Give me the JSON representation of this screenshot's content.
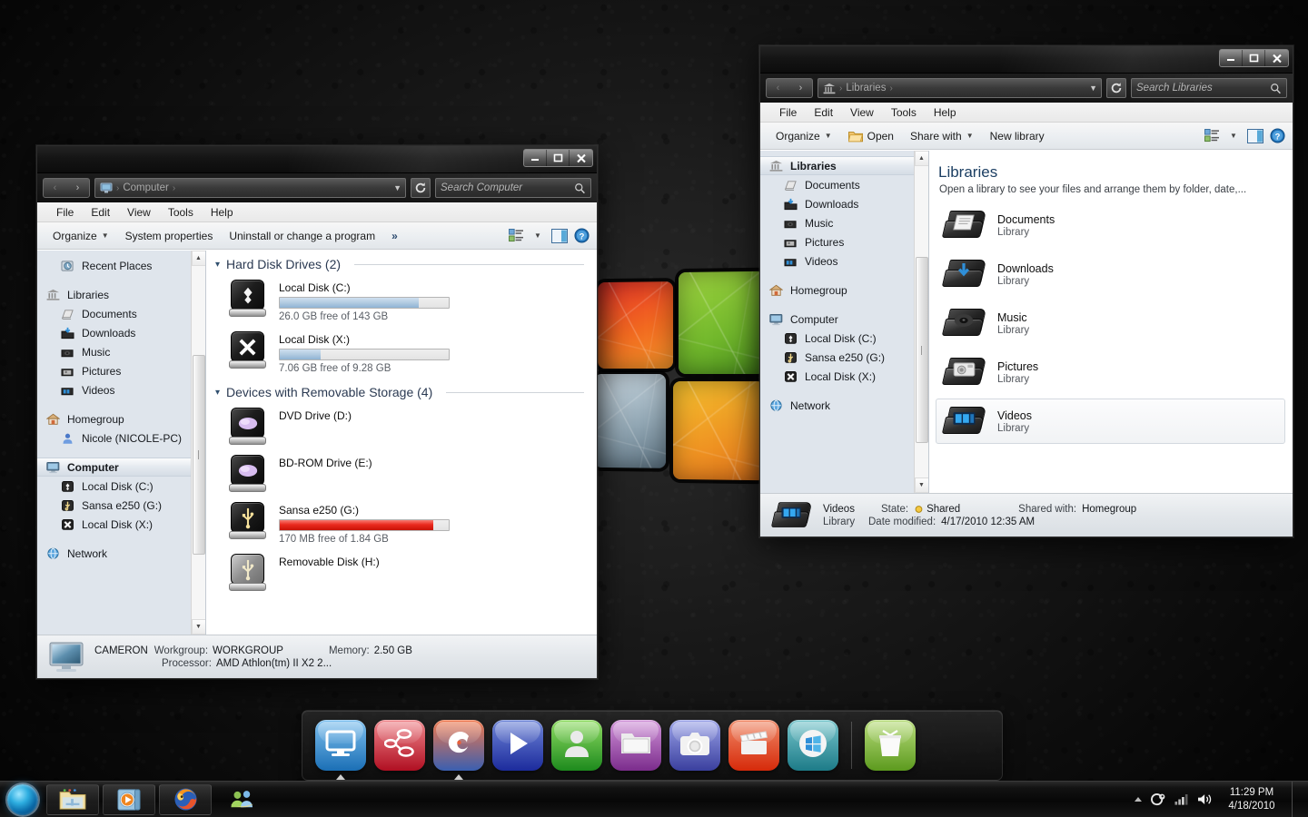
{
  "desktop": {
    "wallpaper_name": "windows-grunge-leather"
  },
  "computer_window": {
    "title": "Computer",
    "controls": {
      "minimize": "minimize-button",
      "maximize": "maximize-button",
      "close": "close-button"
    },
    "nav": {
      "back": "back-button",
      "forward": "forward-button",
      "refresh": "refresh-button"
    },
    "address": {
      "root_icon": "computer-icon",
      "crumb": "Computer",
      "sep": "›"
    },
    "search": {
      "placeholder": "Search Computer",
      "value": ""
    },
    "menu": [
      "File",
      "Edit",
      "View",
      "Tools",
      "Help"
    ],
    "commands": {
      "organize": "Organize",
      "system_properties": "System properties",
      "uninstall": "Uninstall or change a program",
      "overflow": "»",
      "change_view": "change-view-button",
      "preview_pane": "preview-pane-button",
      "help": "help-button"
    },
    "sidebar": [
      {
        "label": "Recent Places",
        "icon": "recent-places-icon",
        "level": "child",
        "selected": false
      },
      {
        "label": "",
        "icon": "",
        "level": "gap",
        "selected": false
      },
      {
        "label": "Libraries",
        "icon": "libraries-icon",
        "level": "root",
        "selected": false
      },
      {
        "label": "Documents",
        "icon": "documents-icon",
        "level": "child",
        "selected": false
      },
      {
        "label": "Downloads",
        "icon": "downloads-icon",
        "level": "child",
        "selected": false
      },
      {
        "label": "Music",
        "icon": "music-icon",
        "level": "child",
        "selected": false
      },
      {
        "label": "Pictures",
        "icon": "pictures-icon",
        "level": "child",
        "selected": false
      },
      {
        "label": "Videos",
        "icon": "videos-icon",
        "level": "child",
        "selected": false
      },
      {
        "label": "",
        "icon": "",
        "level": "gap",
        "selected": false
      },
      {
        "label": "Homegroup",
        "icon": "homegroup-icon",
        "level": "root",
        "selected": false
      },
      {
        "label": "Nicole (NICOLE-PC)",
        "icon": "user-icon",
        "level": "child",
        "selected": false
      },
      {
        "label": "",
        "icon": "",
        "level": "gap",
        "selected": false
      },
      {
        "label": "Computer",
        "icon": "computer-icon",
        "level": "root",
        "selected": true
      },
      {
        "label": "Local Disk (C:)",
        "icon": "local-disk-c-icon",
        "level": "child",
        "selected": false
      },
      {
        "label": "Sansa e250 (G:)",
        "icon": "usb-drive-icon",
        "level": "child",
        "selected": false
      },
      {
        "label": "Local Disk (X:)",
        "icon": "local-disk-x-icon",
        "level": "child",
        "selected": false
      },
      {
        "label": "",
        "icon": "",
        "level": "gap",
        "selected": false
      },
      {
        "label": "Network",
        "icon": "network-icon",
        "level": "root",
        "selected": false
      }
    ],
    "groups": [
      {
        "header": "Hard Disk Drives (2)",
        "drives": [
          {
            "name": "Local Disk (C:)",
            "free": "26.0 GB free of 143 GB",
            "used_percent": 82,
            "bar": "normal",
            "icon": "hard-disk-icon",
            "glyph": "diamonds"
          },
          {
            "name": "Local Disk (X:)",
            "free": "7.06 GB free of 9.28 GB",
            "used_percent": 24,
            "bar": "normal",
            "icon": "hard-disk-x-icon",
            "glyph": "X"
          }
        ]
      },
      {
        "header": "Devices with Removable Storage (4)",
        "drives": [
          {
            "name": "DVD Drive (D:)",
            "free": "",
            "used_percent": 0,
            "bar": "none",
            "icon": "dvd-drive-icon",
            "glyph": "disc"
          },
          {
            "name": "BD-ROM Drive (E:)",
            "free": "",
            "used_percent": 0,
            "bar": "none",
            "icon": "bd-rom-drive-icon",
            "glyph": "disc"
          },
          {
            "name": "Sansa e250 (G:)",
            "free": "170 MB free of 1.84 GB",
            "used_percent": 91,
            "bar": "low",
            "icon": "usb-drive-icon",
            "glyph": "usb"
          },
          {
            "name": "Removable Disk (H:)",
            "free": "",
            "used_percent": 0,
            "bar": "none",
            "icon": "removable-disk-icon",
            "glyph": "usb-grey"
          }
        ]
      }
    ],
    "status": {
      "machine": "CAMERON",
      "workgroup_label": "Workgroup:",
      "workgroup_value": "WORKGROUP",
      "memory_label": "Memory:",
      "memory_value": "2.50 GB",
      "processor_label": "Processor:",
      "processor_value": "AMD Athlon(tm) II X2 2..."
    }
  },
  "libraries_window": {
    "title": "Libraries",
    "nav": {
      "back": "back-button",
      "forward": "forward-button",
      "refresh": "refresh-button"
    },
    "address": {
      "root_icon": "libraries-icon",
      "crumb": "Libraries",
      "sep": "›"
    },
    "search": {
      "placeholder": "Search Libraries",
      "value": ""
    },
    "menu": [
      "File",
      "Edit",
      "View",
      "Tools",
      "Help"
    ],
    "commands": {
      "organize": "Organize",
      "open": "Open",
      "share_with": "Share with",
      "new_library": "New library",
      "change_view": "change-view-button",
      "preview_pane": "preview-pane-button",
      "help": "help-button"
    },
    "sidebar": [
      {
        "label": "Libraries",
        "icon": "libraries-icon",
        "level": "root",
        "selected": true
      },
      {
        "label": "Documents",
        "icon": "documents-icon",
        "level": "child",
        "selected": false
      },
      {
        "label": "Downloads",
        "icon": "downloads-icon",
        "level": "child",
        "selected": false
      },
      {
        "label": "Music",
        "icon": "music-icon",
        "level": "child",
        "selected": false
      },
      {
        "label": "Pictures",
        "icon": "pictures-icon",
        "level": "child",
        "selected": false
      },
      {
        "label": "Videos",
        "icon": "videos-icon",
        "level": "child",
        "selected": false
      },
      {
        "label": "",
        "icon": "",
        "level": "gap",
        "selected": false
      },
      {
        "label": "Homegroup",
        "icon": "homegroup-icon",
        "level": "root",
        "selected": false
      },
      {
        "label": "",
        "icon": "",
        "level": "gap",
        "selected": false
      },
      {
        "label": "Computer",
        "icon": "computer-icon",
        "level": "root",
        "selected": false
      },
      {
        "label": "Local Disk (C:)",
        "icon": "local-disk-c-icon",
        "level": "child",
        "selected": false
      },
      {
        "label": "Sansa e250 (G:)",
        "icon": "usb-drive-icon",
        "level": "child",
        "selected": false
      },
      {
        "label": "Local Disk (X:)",
        "icon": "local-disk-x-icon",
        "level": "child",
        "selected": false
      },
      {
        "label": "",
        "icon": "",
        "level": "gap",
        "selected": false
      },
      {
        "label": "Network",
        "icon": "network-icon",
        "level": "root",
        "selected": false
      }
    ],
    "content_header": {
      "title": "Libraries",
      "subtitle": "Open a library to see your files and arrange them by folder, date,..."
    },
    "items": [
      {
        "name": "Documents",
        "type": "Library",
        "icon": "documents-library-icon",
        "selected": false
      },
      {
        "name": "Downloads",
        "type": "Library",
        "icon": "downloads-library-icon",
        "selected": false
      },
      {
        "name": "Music",
        "type": "Library",
        "icon": "music-library-icon",
        "selected": false
      },
      {
        "name": "Pictures",
        "type": "Library",
        "icon": "pictures-library-icon",
        "selected": false
      },
      {
        "name": "Videos",
        "type": "Library",
        "icon": "videos-library-icon",
        "selected": true
      }
    ],
    "details": {
      "name": "Videos",
      "type": "Library",
      "state_label": "State:",
      "state_value": "Shared",
      "shared_label": "Shared with:",
      "shared_value": "Homegroup",
      "date_label": "Date modified:",
      "date_value": "4/17/2010 12:35 AM"
    }
  },
  "dock": {
    "items": [
      {
        "name": "my-computer",
        "icon": "monitor-icon",
        "c1": "#7ec0ef",
        "c2": "#1b6fb5"
      },
      {
        "name": "network",
        "icon": "network-share-icon",
        "c1": "#f0868c",
        "c2": "#b00f22"
      },
      {
        "name": "firefox",
        "icon": "firefox-icon",
        "c1": "#f2784b",
        "c2": "#3a5fb0"
      },
      {
        "name": "media-player",
        "icon": "play-icon",
        "c1": "#6f86d8",
        "c2": "#1c2b9c"
      },
      {
        "name": "user-account",
        "icon": "person-icon",
        "c1": "#8fdc62",
        "c2": "#1d8a1d"
      },
      {
        "name": "documents-folder",
        "icon": "folder-icon",
        "c1": "#d194d9",
        "c2": "#7b2c8c"
      },
      {
        "name": "photos",
        "icon": "camera-icon",
        "c1": "#9ba3e8",
        "c2": "#3a3f9e"
      },
      {
        "name": "movies",
        "icon": "clapboard-icon",
        "c1": "#f08a68",
        "c2": "#d62a0a"
      },
      {
        "name": "windows-start",
        "icon": "windows-logo-icon",
        "c1": "#78c6cc",
        "c2": "#1d7b88"
      }
    ],
    "trash": {
      "name": "recycle-bin",
      "icon": "trash-icon",
      "c1": "#b9dd7c",
      "c2": "#5c9a1e"
    }
  },
  "taskbar": {
    "start": "start-button",
    "buttons": [
      {
        "name": "windows-explorer",
        "icon": "folder-explorer-icon",
        "active": true
      },
      {
        "name": "windows-media-player",
        "icon": "media-player-icon",
        "active": true
      },
      {
        "name": "firefox",
        "icon": "firefox-icon",
        "active": true
      },
      {
        "name": "windows-live-messenger",
        "icon": "messenger-icon",
        "active": false
      }
    ],
    "tray": {
      "show_hidden": "show-hidden-icons-button",
      "icons": [
        "steam-icon",
        "network-signal-icon",
        "volume-icon"
      ],
      "time": "11:29 PM",
      "date": "4/18/2010",
      "show_desktop": "show-desktop-button"
    }
  }
}
